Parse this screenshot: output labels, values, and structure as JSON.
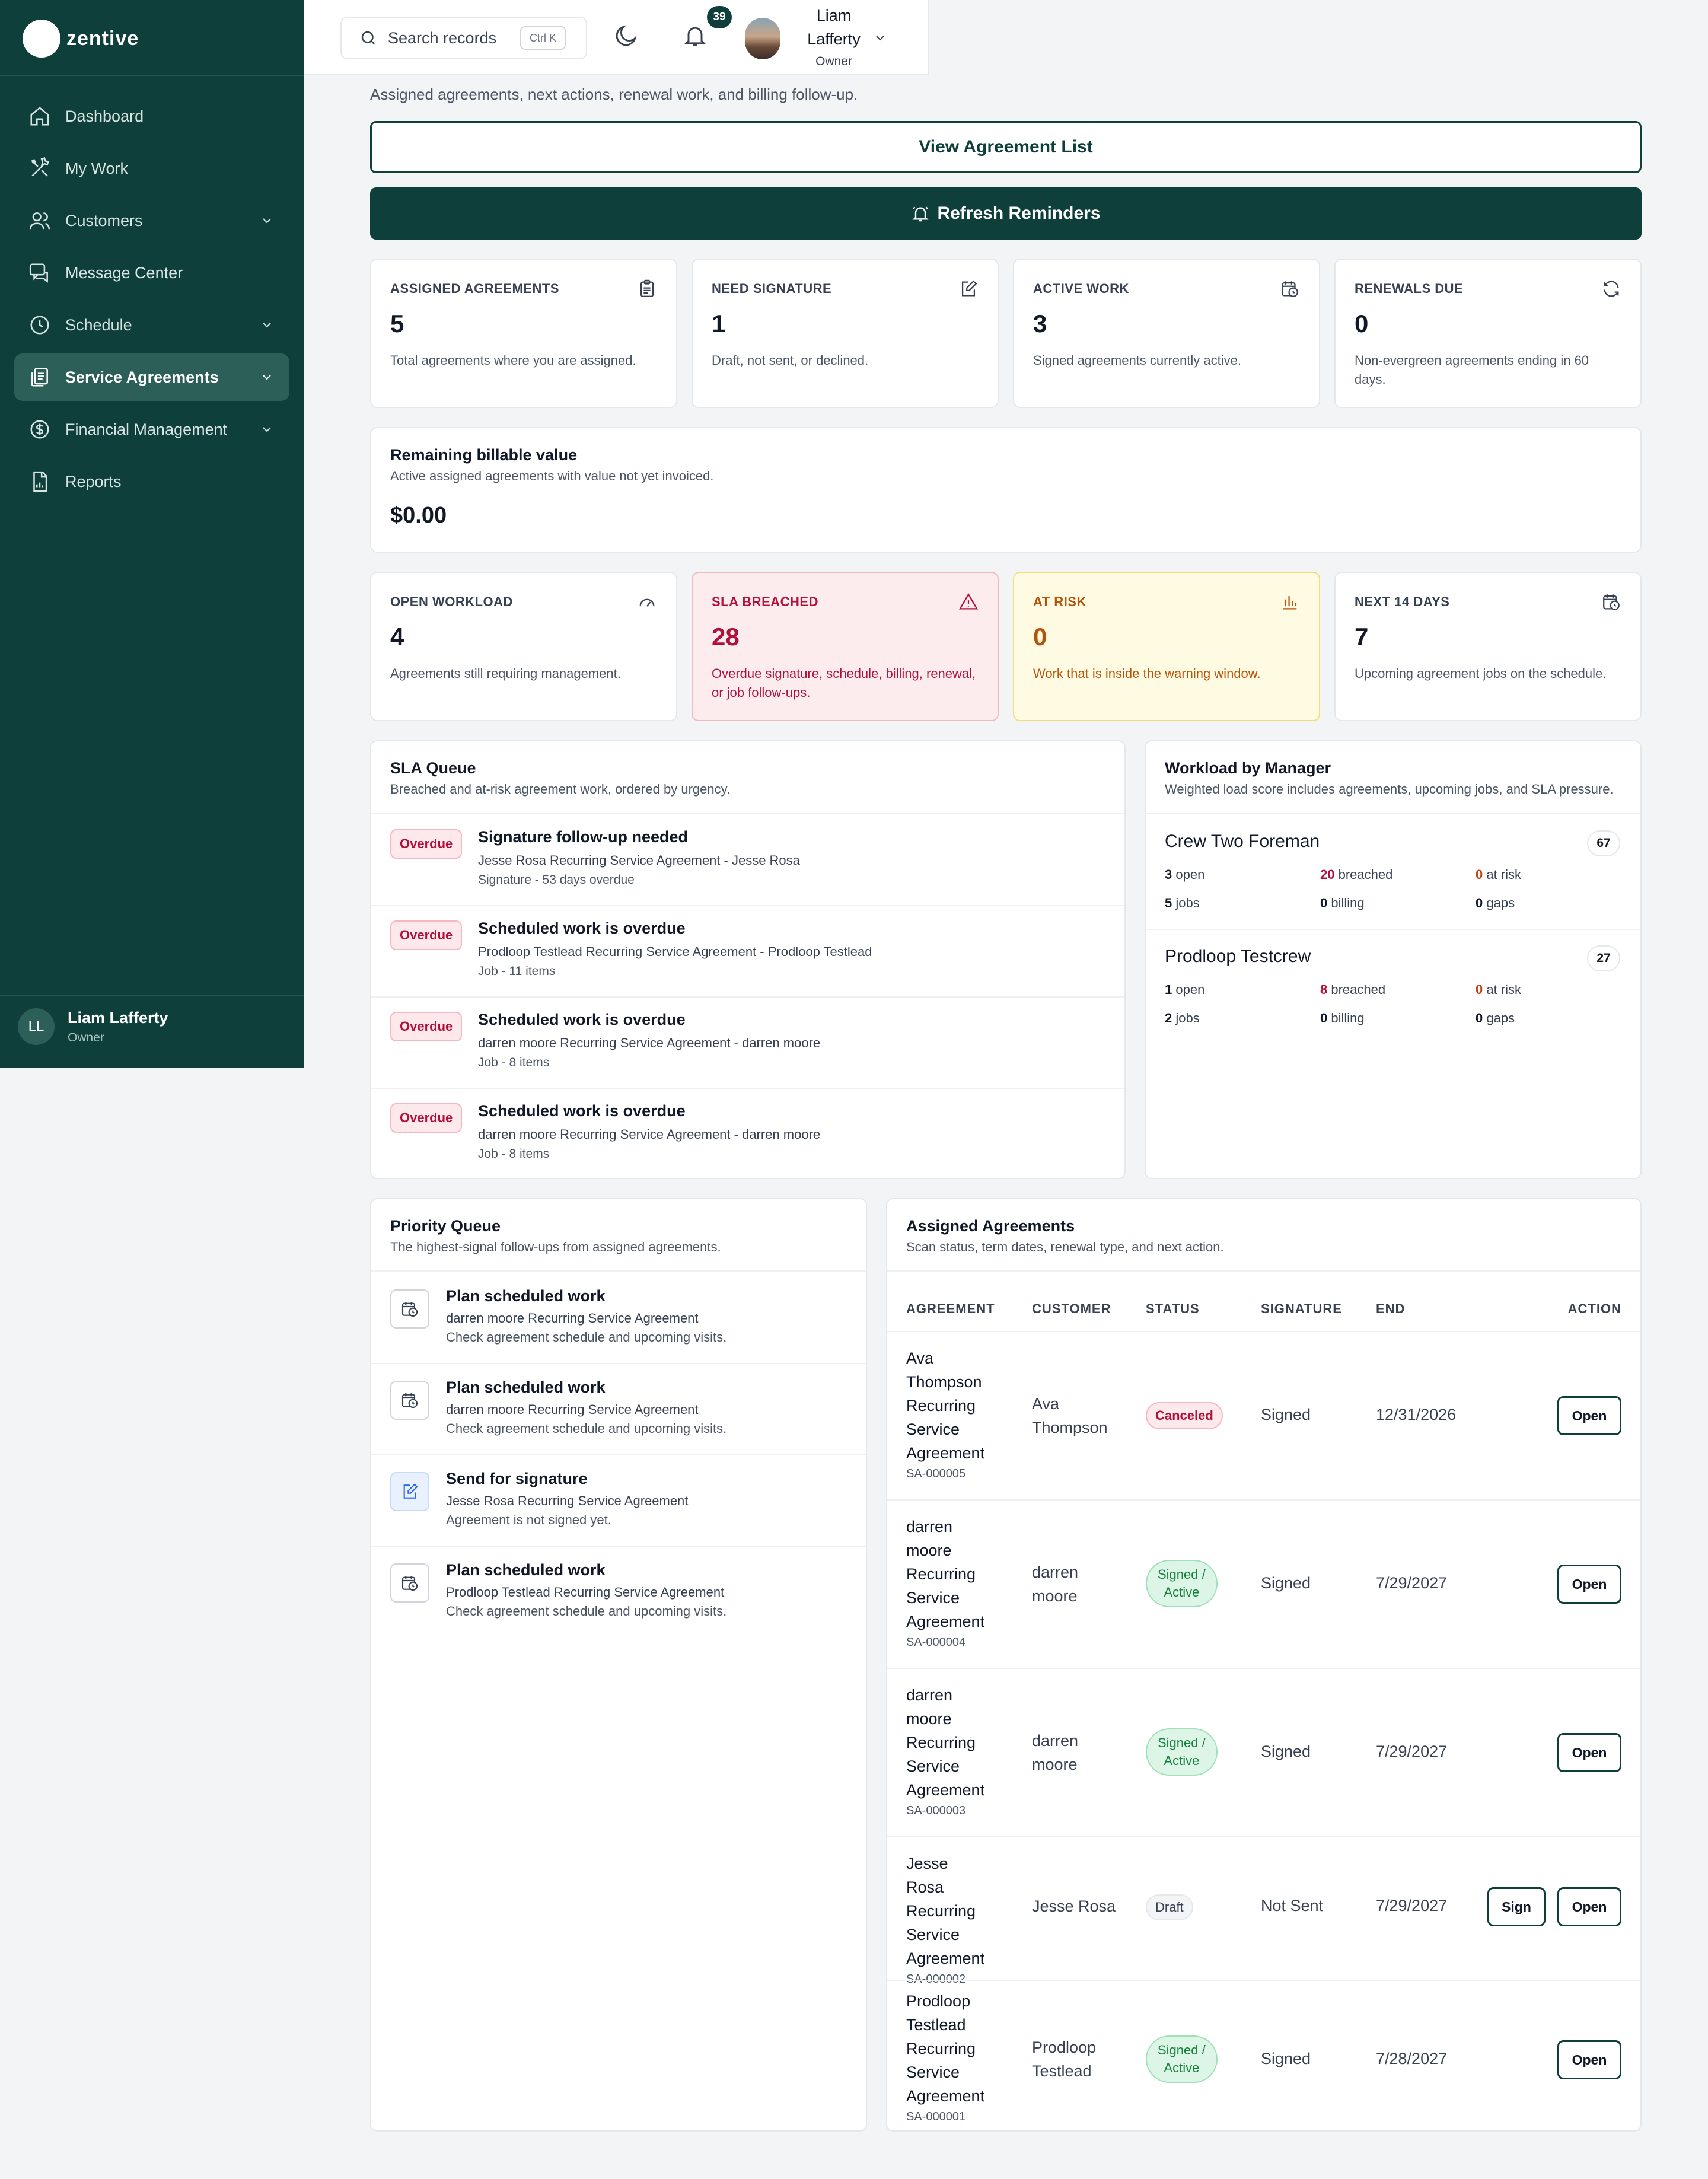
{
  "brand": {
    "name": "zentive"
  },
  "sidebar": {
    "items": [
      {
        "label": "Dashboard"
      },
      {
        "label": "My Work"
      },
      {
        "label": "Customers"
      },
      {
        "label": "Message Center"
      },
      {
        "label": "Schedule"
      },
      {
        "label": "Service Agreements"
      },
      {
        "label": "Financial Management"
      },
      {
        "label": "Reports"
      }
    ],
    "user": {
      "initials": "LL",
      "name": "Liam Lafferty",
      "role": "Owner"
    }
  },
  "topbar": {
    "search_placeholder": "Search records",
    "search_shortcut": "Ctrl K",
    "notification_count": "39",
    "user_name": "Liam Lafferty",
    "user_role": "Owner"
  },
  "page": {
    "subtitle": "Assigned agreements, next actions, renewal work, and billing follow-up.",
    "view_list_label": "View Agreement List",
    "refresh_label": "Refresh Reminders"
  },
  "stats_top": [
    {
      "label": "ASSIGNED AGREEMENTS",
      "value": "5",
      "desc": "Total agreements where you are assigned."
    },
    {
      "label": "NEED SIGNATURE",
      "value": "1",
      "desc": "Draft, not sent, or declined."
    },
    {
      "label": "ACTIVE WORK",
      "value": "3",
      "desc": "Signed agreements currently active."
    },
    {
      "label": "RENEWALS DUE",
      "value": "0",
      "desc": "Non-evergreen agreements ending in 60 days."
    }
  ],
  "billable": {
    "title": "Remaining billable value",
    "sub": "Active assigned agreements with value not yet invoiced.",
    "value": "$0.00"
  },
  "stats_mid": [
    {
      "label": "OPEN WORKLOAD",
      "value": "4",
      "desc": "Agreements still requiring management."
    },
    {
      "label": "SLA BREACHED",
      "value": "28",
      "desc": "Overdue signature, schedule, billing, renewal, or job follow-ups."
    },
    {
      "label": "AT RISK",
      "value": "0",
      "desc": "Work that is inside the warning window."
    },
    {
      "label": "NEXT 14 DAYS",
      "value": "7",
      "desc": "Upcoming agreement jobs on the schedule."
    }
  ],
  "sla_queue": {
    "title": "SLA Queue",
    "sub": "Breached and at-risk agreement work, ordered by urgency.",
    "items": [
      {
        "badge": "Overdue",
        "title": "Signature follow-up needed",
        "sub": "Jesse Rosa Recurring Service Agreement - Jesse Rosa",
        "meta": "Signature - 53 days overdue"
      },
      {
        "badge": "Overdue",
        "title": "Scheduled work is overdue",
        "sub": "Prodloop Testlead Recurring Service Agreement - Prodloop Testlead",
        "meta": "Job - 11 items"
      },
      {
        "badge": "Overdue",
        "title": "Scheduled work is overdue",
        "sub": "darren moore Recurring Service Agreement - darren moore",
        "meta": "Job - 8 items"
      },
      {
        "badge": "Overdue",
        "title": "Scheduled work is overdue",
        "sub": "darren moore Recurring Service Agreement - darren moore",
        "meta": "Job - 8 items"
      }
    ]
  },
  "workload": {
    "title": "Workload by Manager",
    "sub": "Weighted load score includes agreements, upcoming jobs, and SLA pressure.",
    "labels": {
      "open": "open",
      "breached": "breached",
      "at_risk": "at risk",
      "jobs": "jobs",
      "billing": "billing",
      "gaps": "gaps"
    },
    "managers": [
      {
        "name": "Crew Two Foreman",
        "score": "67",
        "open": "3",
        "breached": "20",
        "at_risk": "0",
        "jobs": "5",
        "billing": "0",
        "gaps": "0"
      },
      {
        "name": "Prodloop Testcrew",
        "score": "27",
        "open": "1",
        "breached": "8",
        "at_risk": "0",
        "jobs": "2",
        "billing": "0",
        "gaps": "0"
      }
    ]
  },
  "priority_queue": {
    "title": "Priority Queue",
    "sub": "The highest-signal follow-ups from assigned agreements.",
    "items": [
      {
        "icon": "calendar-clock-icon",
        "title": "Plan scheduled work",
        "sub": "darren moore Recurring Service Agreement",
        "meta": "Check agreement schedule and upcoming visits."
      },
      {
        "icon": "calendar-clock-icon",
        "title": "Plan scheduled work",
        "sub": "darren moore Recurring Service Agreement",
        "meta": "Check agreement schedule and upcoming visits."
      },
      {
        "icon": "signature-icon",
        "title": "Send for signature",
        "sub": "Jesse Rosa Recurring Service Agreement",
        "meta": "Agreement is not signed yet."
      },
      {
        "icon": "calendar-clock-icon",
        "title": "Plan scheduled work",
        "sub": "Prodloop Testlead Recurring Service Agreement",
        "meta": "Check agreement schedule and upcoming visits."
      }
    ]
  },
  "agreements": {
    "title": "Assigned Agreements",
    "sub": "Scan status, term dates, renewal type, and next action.",
    "columns": [
      "AGREEMENT",
      "CUSTOMER",
      "STATUS",
      "SIGNATURE",
      "END",
      "ACTION"
    ],
    "rows": [
      {
        "name": [
          "Ava",
          "Thompson",
          "Recurring",
          "Service",
          "Agreement"
        ],
        "id": "SA-000005",
        "customer": [
          "Ava",
          "Thompson"
        ],
        "status": [
          "Canceled"
        ],
        "signature": "Signed",
        "end": "12/31/2026",
        "actions": [
          "Open"
        ]
      },
      {
        "name": [
          "darren",
          "moore",
          "Recurring",
          "Service",
          "Agreement"
        ],
        "id": "SA-000004",
        "customer": [
          "darren",
          "moore"
        ],
        "status": [
          "Signed /",
          "Active"
        ],
        "signature": "Signed",
        "end": "7/29/2027",
        "actions": [
          "Open"
        ]
      },
      {
        "name": [
          "darren",
          "moore",
          "Recurring",
          "Service",
          "Agreement"
        ],
        "id": "SA-000003",
        "customer": [
          "darren",
          "moore"
        ],
        "status": [
          "Signed /",
          "Active"
        ],
        "signature": "Signed",
        "end": "7/29/2027",
        "actions": [
          "Open"
        ]
      },
      {
        "name": [
          "Jesse Rosa",
          "Recurring",
          "Service",
          "Agreement"
        ],
        "id": "SA-000002",
        "customer": [
          "Jesse Rosa"
        ],
        "status": [
          "Draft"
        ],
        "signature": "Not Sent",
        "end": "7/29/2027",
        "actions": [
          "Sign",
          "Open"
        ]
      },
      {
        "name": [
          "Prodloop",
          "Testlead",
          "Recurring",
          "Service",
          "Agreement"
        ],
        "id": "SA-000001",
        "customer": [
          "Prodloop",
          "Testlead"
        ],
        "status": [
          "Signed /",
          "Active"
        ],
        "signature": "Signed",
        "end": "7/28/2027",
        "actions": [
          "Open"
        ]
      }
    ]
  }
}
